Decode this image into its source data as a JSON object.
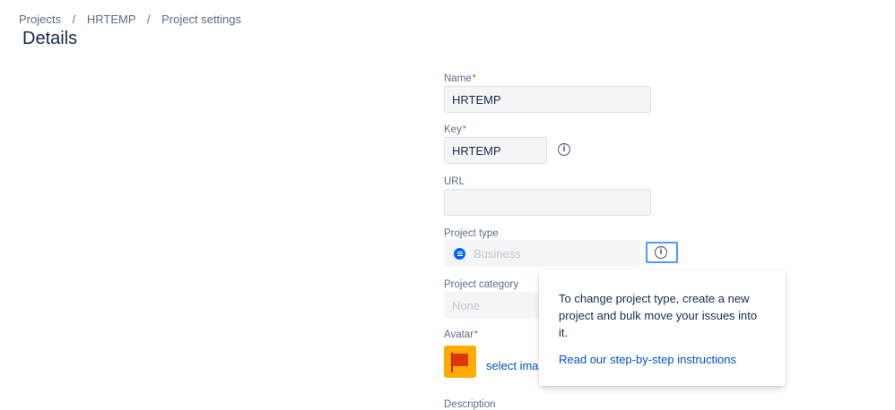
{
  "breadcrumb": {
    "items": [
      "Projects",
      "HRTEMP",
      "Project settings"
    ],
    "separator": "/"
  },
  "page": {
    "title": "Details"
  },
  "form": {
    "name": {
      "label": "Name",
      "required_mark": "*",
      "value": "HRTEMP"
    },
    "key": {
      "label": "Key",
      "required_mark": "*",
      "value": "HRTEMP",
      "info_icon": "info-icon"
    },
    "url": {
      "label": "URL",
      "value": ""
    },
    "project_type": {
      "label": "Project type",
      "value": "Business",
      "icon": "business-icon",
      "info_icon": "info-icon"
    },
    "project_category": {
      "label": "Project category",
      "value": "None"
    },
    "avatar": {
      "label": "Avatar",
      "required_mark": "*",
      "select_label": "select image"
    },
    "description": {
      "label": "Description"
    }
  },
  "popup": {
    "text": "To change project type, create a new project and bulk move your issues into it.",
    "link": "Read our step-by-step instructions"
  },
  "colors": {
    "link": "#0052cc",
    "focus_ring": "#4c9aff",
    "required": "#de350b",
    "avatar_bg": "#ffab00"
  }
}
